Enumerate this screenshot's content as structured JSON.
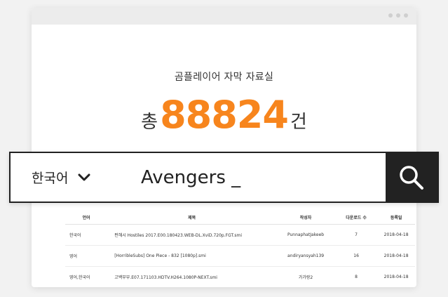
{
  "header": {
    "title": "곰플레이어 자막 자료실",
    "total_prefix": "총",
    "total_count": "88824",
    "total_suffix": "건"
  },
  "search": {
    "language_selected": "한국어",
    "query": "Avengers _",
    "icon": "search-icon",
    "dropdown_icon": "chevron-down-icon"
  },
  "table": {
    "columns": [
      "언어",
      "제목",
      "작성자",
      "다운로드 수",
      "등록일"
    ],
    "rows": [
      {
        "language": "한국어",
        "title": "펀해시 Hostiles 2017.E00.180423.WEB-DL.XviD.720p.FGT.smi",
        "author": "PunnaphatJakeeb",
        "downloads": "7",
        "date": "2018-04-18"
      },
      {
        "language": "영어",
        "title": "[HorribleSubs] One Piece - 832 [1080p].smi",
        "author": "andiryansyah139",
        "downloads": "16",
        "date": "2018-04-18"
      },
      {
        "language": "영어,한국어",
        "title": "고백부부.E07.171103.HDTV.H264.1080P-NEXT.smi",
        "author": "가가랑2",
        "downloads": "8",
        "date": "2018-04-18"
      }
    ]
  },
  "colors": {
    "accent": "#f7851d",
    "dark": "#222222"
  }
}
